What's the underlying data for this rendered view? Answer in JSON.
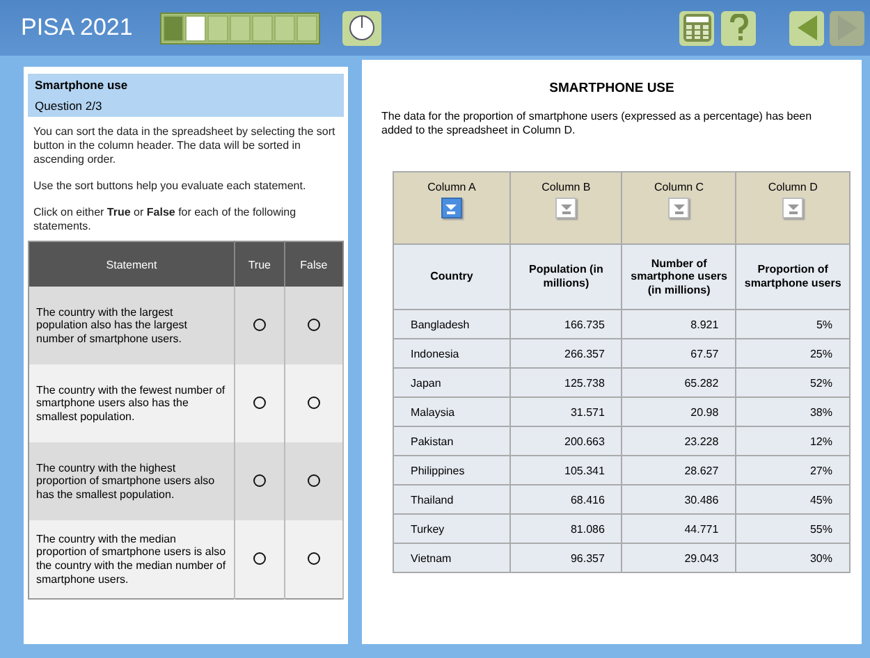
{
  "header": {
    "title": "PISA 2021",
    "progress": [
      {
        "done": true,
        "current": false
      },
      {
        "done": false,
        "current": true
      },
      {
        "done": false,
        "current": false
      },
      {
        "done": false,
        "current": false
      },
      {
        "done": false,
        "current": false
      },
      {
        "done": false,
        "current": false
      },
      {
        "done": false,
        "current": false
      }
    ],
    "nav": [
      {
        "kind": "back",
        "disabled": false
      },
      {
        "kind": "next",
        "disabled": true
      }
    ]
  },
  "question": {
    "unit": "Smartphone use",
    "number": "Question 2/3",
    "instructions": [
      "You can sort the data in the spreadsheet by selecting the sort button in the column header. The data will be sorted in ascending order.",
      "Use the sort buttons help you evaluate each statement.",
      "Click on either **True** or **False** for each of the following statements."
    ],
    "columns": [
      "Statement",
      "True",
      "False"
    ],
    "statements": [
      {
        "text": "The country with the largest population also has the largest number of smartphone users.",
        "true_checked": false,
        "false_checked": false
      },
      {
        "text": "The country with the fewest number of smartphone users also has the smallest population.",
        "true_checked": false,
        "false_checked": false
      },
      {
        "text": "The country with the highest proportion of smartphone users also has the smallest population.",
        "true_checked": false,
        "false_checked": false
      },
      {
        "text": "The country with the median proportion of smartphone users is also the country with the median number of smartphone users.",
        "true_checked": false,
        "false_checked": false
      }
    ]
  },
  "stimulus": {
    "title": "SMARTPHONE USE",
    "text": "The data for the proportion of smartphone users (expressed as a percentage) has been added to the spreadsheet in Column D.",
    "spreadsheet": {
      "columns": [
        {
          "letter": "Column A",
          "heading": "Country",
          "sorted": true
        },
        {
          "letter": "Column B",
          "heading": "Population (in millions)",
          "sorted": false
        },
        {
          "letter": "Column C",
          "heading": "Number of smartphone users (in millions)",
          "sorted": false
        },
        {
          "letter": "Column D",
          "heading": "Proportion of smartphone users",
          "sorted": false
        }
      ],
      "rows": [
        [
          "Bangladesh",
          "166.735",
          "8.921",
          "5%"
        ],
        [
          "Indonesia",
          "266.357",
          "67.57",
          "25%"
        ],
        [
          "Japan",
          "125.738",
          "65.282",
          "52%"
        ],
        [
          "Malaysia",
          "31.571",
          "20.98",
          "38%"
        ],
        [
          "Pakistan",
          "200.663",
          "23.228",
          "12%"
        ],
        [
          "Philippines",
          "105.341",
          "28.627",
          "27%"
        ],
        [
          "Thailand",
          "68.416",
          "30.486",
          "45%"
        ],
        [
          "Turkey",
          "81.086",
          "44.771",
          "55%"
        ],
        [
          "Vietnam",
          "96.357",
          "29.043",
          "30%"
        ]
      ]
    }
  }
}
